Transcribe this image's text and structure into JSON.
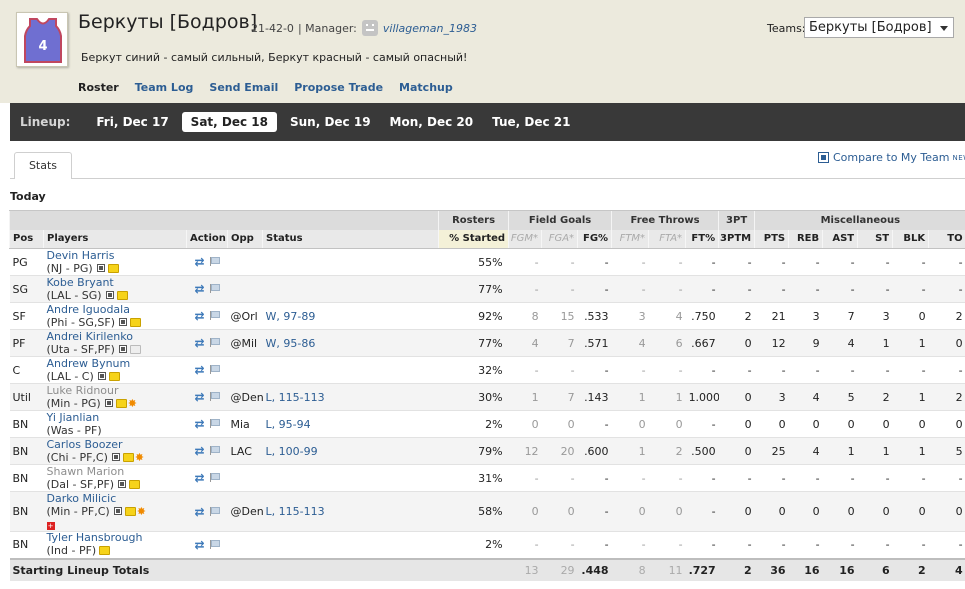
{
  "team": {
    "name": "Беркуты [Бодров]",
    "record": "21-42-0",
    "manager_label": "| Manager:",
    "manager_name": "villageman_1983",
    "motto": "Беркут синий - самый сильный, Беркут красный - самый опасный!",
    "jersey_number": "4",
    "jersey_color": "#6f6fd1",
    "jersey_trim": "#c0475f"
  },
  "team_nav": [
    "Roster",
    "Team Log",
    "Send Email",
    "Propose Trade",
    "Matchup"
  ],
  "teams_selector": {
    "label": "Teams:",
    "selected": "Беркуты [Бодров]"
  },
  "lineup": {
    "label": "Lineup:",
    "days": [
      "Fri, Dec 17",
      "Sat, Dec 18",
      "Sun, Dec 19",
      "Mon, Dec 20",
      "Tue, Dec 21"
    ],
    "active_index": 1
  },
  "tabs": {
    "stats": "Stats"
  },
  "compare": {
    "label": "Compare to My Team",
    "badge": "NEW!"
  },
  "section_title": "Today",
  "table": {
    "groups": {
      "rosters": "Rosters",
      "field_goals": "Field Goals",
      "free_throws": "Free Throws",
      "three_pt": "3PT",
      "misc": "Miscellaneous"
    },
    "columns": {
      "pos": "Pos",
      "players": "Players",
      "action": "Action",
      "opp": "Opp",
      "status": "Status",
      "started": "% Started",
      "fgm": "FGM*",
      "fga": "FGA*",
      "fgp": "FG%",
      "ftm": "FTM*",
      "fta": "FTA*",
      "ftp": "FT%",
      "tpm": "3PTM",
      "pts": "PTS",
      "reb": "REB",
      "ast": "AST",
      "st": "ST",
      "blk": "BLK",
      "to": "TO"
    },
    "rows": [
      {
        "pos": "PG",
        "name": "Devin Harris",
        "team": "(NJ - PG)",
        "opp": "",
        "status": "",
        "started": "55%",
        "fgm": "-",
        "fga": "-",
        "fgp": "-",
        "ftm": "-",
        "fta": "-",
        "ftp": "-",
        "tpm": "-",
        "pts": "-",
        "reb": "-",
        "ast": "-",
        "st": "-",
        "blk": "-",
        "to": "-"
      },
      {
        "pos": "SG",
        "name": "Kobe Bryant",
        "team": "(LAL - SG)",
        "opp": "",
        "status": "",
        "started": "77%",
        "fgm": "-",
        "fga": "-",
        "fgp": "-",
        "ftm": "-",
        "fta": "-",
        "ftp": "-",
        "tpm": "-",
        "pts": "-",
        "reb": "-",
        "ast": "-",
        "st": "-",
        "blk": "-",
        "to": "-"
      },
      {
        "pos": "SF",
        "name": "Andre Iguodala",
        "team": "(Phi - SG,SF)",
        "opp": "@Orl",
        "status": "W, 97-89",
        "started": "92%",
        "fgm": "8",
        "fga": "15",
        "fgp": ".533",
        "ftm": "3",
        "fta": "4",
        "ftp": ".750",
        "tpm": "2",
        "pts": "21",
        "reb": "3",
        "ast": "7",
        "st": "3",
        "blk": "0",
        "to": "2"
      },
      {
        "pos": "PF",
        "name": "Andrei Kirilenko",
        "team": "(Uta - SF,PF)",
        "opp": "@Mil",
        "status": "W, 95-86",
        "started": "77%",
        "fgm": "4",
        "fga": "7",
        "fgp": ".571",
        "ftm": "4",
        "fta": "6",
        "ftp": ".667",
        "tpm": "0",
        "pts": "12",
        "reb": "9",
        "ast": "4",
        "st": "1",
        "blk": "1",
        "to": "0"
      },
      {
        "pos": "C",
        "name": "Andrew Bynum",
        "team": "(LAL - C)",
        "opp": "",
        "status": "",
        "started": "32%",
        "fgm": "-",
        "fga": "-",
        "fgp": "-",
        "ftm": "-",
        "fta": "-",
        "ftp": "-",
        "tpm": "-",
        "pts": "-",
        "reb": "-",
        "ast": "-",
        "st": "-",
        "blk": "-",
        "to": "-"
      },
      {
        "pos": "Util",
        "name": "Luke Ridnour",
        "team": "(Min - PG)",
        "opp": "@Den",
        "status": "L, 115-113",
        "started": "30%",
        "fgm": "1",
        "fga": "7",
        "fgp": ".143",
        "ftm": "1",
        "fta": "1",
        "ftp": "1.000",
        "tpm": "0",
        "pts": "3",
        "reb": "4",
        "ast": "5",
        "st": "2",
        "blk": "1",
        "to": "2"
      },
      {
        "pos": "BN",
        "name": "Yi Jianlian",
        "team": "(Was - PF)",
        "opp": "Mia",
        "status": "L, 95-94",
        "started": "2%",
        "fgm": "0",
        "fga": "0",
        "fgp": "-",
        "ftm": "0",
        "fta": "0",
        "ftp": "-",
        "tpm": "0",
        "pts": "0",
        "reb": "0",
        "ast": "0",
        "st": "0",
        "blk": "0",
        "to": "0"
      },
      {
        "pos": "BN",
        "name": "Carlos Boozer",
        "team": "(Chi - PF,C)",
        "opp": "LAC",
        "status": "L, 100-99",
        "started": "79%",
        "fgm": "12",
        "fga": "20",
        "fgp": ".600",
        "ftm": "1",
        "fta": "2",
        "ftp": ".500",
        "tpm": "0",
        "pts": "25",
        "reb": "4",
        "ast": "1",
        "st": "1",
        "blk": "1",
        "to": "5"
      },
      {
        "pos": "BN",
        "name": "Shawn Marion",
        "team": "(Dal - SF,PF)",
        "opp": "",
        "status": "",
        "started": "31%",
        "fgm": "-",
        "fga": "-",
        "fgp": "-",
        "ftm": "-",
        "fta": "-",
        "ftp": "-",
        "tpm": "-",
        "pts": "-",
        "reb": "-",
        "ast": "-",
        "st": "-",
        "blk": "-",
        "to": "-"
      },
      {
        "pos": "BN",
        "name": "Darko Milicic",
        "team": "(Min - PF,C)",
        "opp": "@Den",
        "status": "L, 115-113",
        "started": "58%",
        "fgm": "0",
        "fga": "0",
        "fgp": "-",
        "ftm": "0",
        "fta": "0",
        "ftp": "-",
        "tpm": "0",
        "pts": "0",
        "reb": "0",
        "ast": "0",
        "st": "0",
        "blk": "0",
        "to": "0"
      },
      {
        "pos": "BN",
        "name": "Tyler Hansbrough",
        "team": "(Ind - PF)",
        "opp": "",
        "status": "",
        "started": "2%",
        "fgm": "-",
        "fga": "-",
        "fgp": "-",
        "ftm": "-",
        "fta": "-",
        "ftp": "-",
        "tpm": "-",
        "pts": "-",
        "reb": "-",
        "ast": "-",
        "st": "-",
        "blk": "-",
        "to": "-"
      }
    ],
    "totals": {
      "label": "Starting Lineup Totals",
      "fgm": "13",
      "fga": "29",
      "fgp": ".448",
      "ftm": "8",
      "fta": "11",
      "ftp": ".727",
      "tpm": "2",
      "pts": "36",
      "reb": "16",
      "ast": "16",
      "st": "6",
      "blk": "2",
      "to": "4"
    }
  }
}
